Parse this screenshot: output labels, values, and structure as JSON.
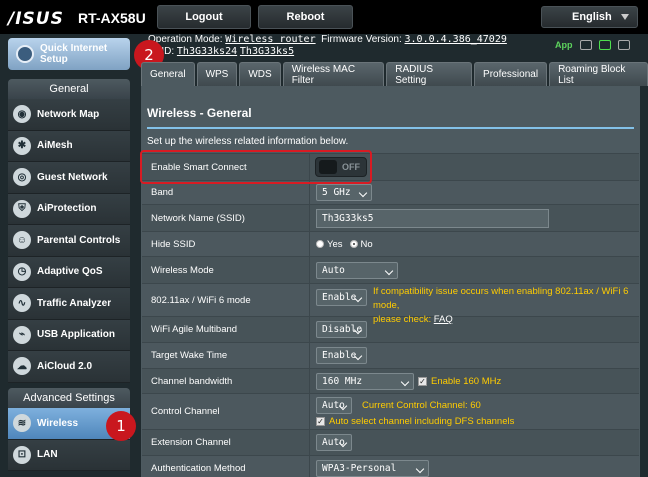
{
  "topbar": {
    "brand": "/ISUS",
    "model": "RT-AX58U",
    "logout": "Logout",
    "reboot": "Reboot",
    "language": "English"
  },
  "info": {
    "op_mode_label": "Operation Mode:",
    "op_mode_value": "Wireless router",
    "fw_label": "Firmware Version:",
    "fw_value": "3.0.0.4.386_47029",
    "ssid_label": "SSID:",
    "ssid_1": "Th3G33ks24",
    "ssid_2": "Th3G33ks5",
    "app_label": "App"
  },
  "sidebar": {
    "quick_setup": [
      "Quick Internet",
      "Setup"
    ],
    "general_header": "General",
    "general_items": [
      {
        "label": "Network Map",
        "icon": "network-map-icon"
      },
      {
        "label": "AiMesh",
        "icon": "aimesh-icon"
      },
      {
        "label": "Guest Network",
        "icon": "guest-network-icon"
      },
      {
        "label": "AiProtection",
        "icon": "shield-icon"
      },
      {
        "label": "Parental Controls",
        "icon": "parental-icon"
      },
      {
        "label": "Adaptive QoS",
        "icon": "qos-icon"
      },
      {
        "label": "Traffic Analyzer",
        "icon": "traffic-icon"
      },
      {
        "label": "USB Application",
        "icon": "usb-icon"
      },
      {
        "label": "AiCloud 2.0",
        "icon": "cloud-icon"
      }
    ],
    "advanced_header": "Advanced Settings",
    "advanced_items": [
      {
        "label": "Wireless",
        "icon": "wifi-icon"
      },
      {
        "label": "LAN",
        "icon": "lan-icon"
      }
    ]
  },
  "badges": {
    "one": "1",
    "two": "2"
  },
  "tabs": [
    "General",
    "WPS",
    "WDS",
    "Wireless MAC Filter",
    "RADIUS Setting",
    "Professional",
    "Roaming Block List"
  ],
  "panel": {
    "title": "Wireless - General",
    "description": "Set up the wireless related information below.",
    "rows": {
      "smart_connect": {
        "label": "Enable Smart Connect",
        "toggle": "OFF"
      },
      "band": {
        "label": "Band",
        "value": "5 GHz"
      },
      "ssid": {
        "label": "Network Name (SSID)",
        "value": "Th3G33ks5"
      },
      "hide_ssid": {
        "label": "Hide SSID",
        "yes": "Yes",
        "no": "No"
      },
      "mode": {
        "label": "Wireless Mode",
        "value": "Auto"
      },
      "wifi6": {
        "label": "802.11ax / WiFi 6 mode",
        "value": "Enable",
        "warn": "If compatibility issue occurs when enabling 802.11ax / WiFi 6 mode,",
        "warn2": "please check:",
        "faq": "FAQ"
      },
      "agile": {
        "label": "WiFi Agile Multiband",
        "value": "Disable"
      },
      "twt": {
        "label": "Target Wake Time",
        "value": "Enable"
      },
      "bandwidth": {
        "label": "Channel bandwidth",
        "value": "160 MHz",
        "check": "Enable 160 MHz"
      },
      "control": {
        "label": "Control Channel",
        "value": "Auto",
        "current": "Current Control Channel: 60",
        "dfs": "Auto select channel including DFS channels"
      },
      "extension": {
        "label": "Extension Channel",
        "value": "Auto"
      },
      "auth": {
        "label": "Authentication Method",
        "value": "WPA3-Personal"
      }
    }
  }
}
